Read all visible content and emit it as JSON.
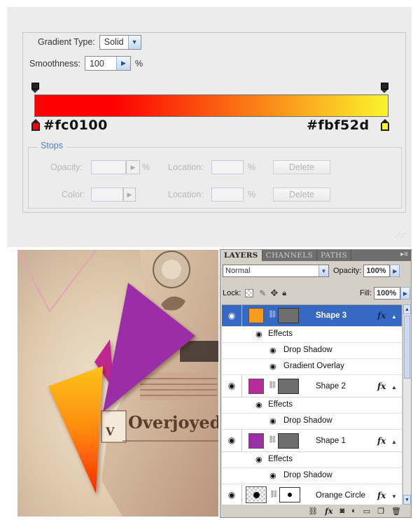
{
  "gradient_editor": {
    "gradient_type_label": "Gradient Type:",
    "gradient_type_value": "Solid",
    "smoothness_label": "Smoothness:",
    "smoothness_value": "100",
    "smoothness_unit": "%",
    "start_color": "#fc0100",
    "end_color": "#fbf52d",
    "stops_label": "Stops",
    "opacity_label": "Opacity:",
    "color_label": "Color:",
    "location_label": "Location:",
    "percent": "%",
    "delete_label": "Delete"
  },
  "artwork": {
    "newspaper_text": "Overjoyed",
    "newspaper_letter": "V",
    "colors": {
      "purple": "#9b2fa6",
      "magenta": "#c0288e",
      "orange": "#ff6a00",
      "yellow": "#fbc21b"
    }
  },
  "layers_panel": {
    "tabs": [
      "LAYERS",
      "CHANNELS",
      "PATHS"
    ],
    "blend_mode": "Normal",
    "opacity_label": "Opacity:",
    "opacity_value": "100%",
    "lock_label": "Lock:",
    "fill_label": "Fill:",
    "fill_value": "100%",
    "layers": [
      {
        "name": "Shape 3",
        "color": "#f99b1c",
        "selected": true,
        "effects_label": "Effects",
        "effects": [
          "Drop Shadow",
          "Gradient Overlay"
        ]
      },
      {
        "name": "Shape 2",
        "color": "#b52c9a",
        "selected": false,
        "effects_label": "Effects",
        "effects": [
          "Drop Shadow"
        ]
      },
      {
        "name": "Shape 1",
        "color": "#9b2fa6",
        "selected": false,
        "effects_label": "Effects",
        "effects": [
          "Drop Shadow"
        ]
      },
      {
        "name": "Orange Circle",
        "selected": false
      }
    ],
    "fx_label": "fx"
  }
}
